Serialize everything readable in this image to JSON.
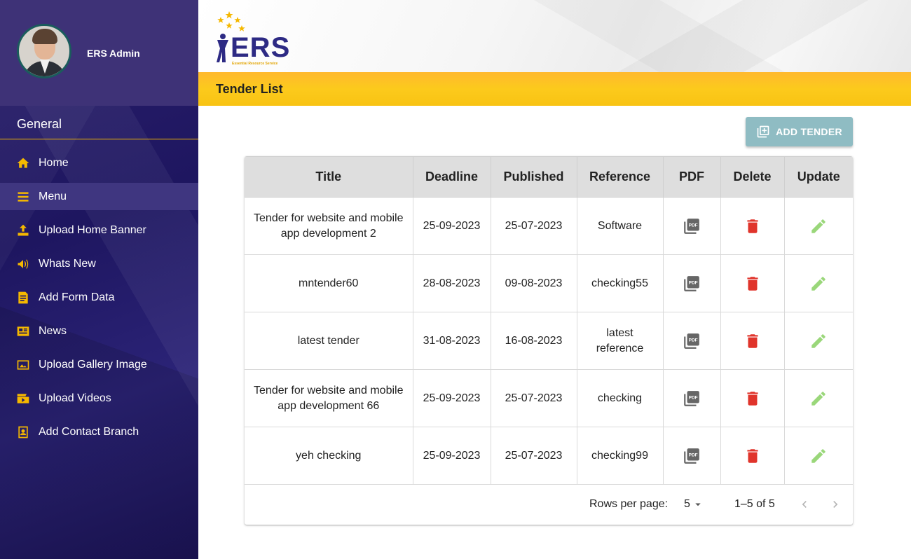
{
  "sidebar": {
    "profile": {
      "name": "ERS Admin"
    },
    "section_title": "General",
    "items": [
      {
        "label": "Home",
        "icon": "home-icon"
      },
      {
        "label": "Menu",
        "icon": "menu-icon",
        "active": true
      },
      {
        "label": "Upload Home Banner",
        "icon": "upload-icon"
      },
      {
        "label": "Whats New",
        "icon": "megaphone-icon"
      },
      {
        "label": "Add Form Data",
        "icon": "form-icon"
      },
      {
        "label": "News",
        "icon": "newspaper-icon"
      },
      {
        "label": "Upload Gallery Image",
        "icon": "gallery-icon"
      },
      {
        "label": "Upload Videos",
        "icon": "video-icon"
      },
      {
        "label": "Add Contact Branch",
        "icon": "contact-icon"
      }
    ]
  },
  "header": {
    "logo_text": "ERS",
    "logo_subtext": "Essential Resource Service"
  },
  "page": {
    "title": "Tender List",
    "add_button_label": "ADD TENDER"
  },
  "table": {
    "columns": [
      "Title",
      "Deadline",
      "Published",
      "Reference",
      "PDF",
      "Delete",
      "Update"
    ],
    "rows": [
      {
        "title": "Tender for website and mobile app development 2",
        "deadline": "25-09-2023",
        "published": "25-07-2023",
        "reference": "Software"
      },
      {
        "title": "mntender60",
        "deadline": "28-08-2023",
        "published": "09-08-2023",
        "reference": "checking55"
      },
      {
        "title": "latest tender",
        "deadline": "31-08-2023",
        "published": "16-08-2023",
        "reference": "latest reference"
      },
      {
        "title": "Tender for website and mobile app development 66",
        "deadline": "25-09-2023",
        "published": "25-07-2023",
        "reference": "checking"
      },
      {
        "title": "yeh checking",
        "deadline": "25-09-2023",
        "published": "25-07-2023",
        "reference": "checking99"
      }
    ]
  },
  "pagination": {
    "rows_per_page_label": "Rows per page:",
    "rows_per_page_value": "5",
    "range_text": "1–5 of 5"
  },
  "colors": {
    "sidebar_bg": "#231a63",
    "accent_yellow": "#f5b800",
    "delete_red": "#e0342b",
    "edit_green": "#9ad77a",
    "add_button": "#8fbcc3"
  }
}
